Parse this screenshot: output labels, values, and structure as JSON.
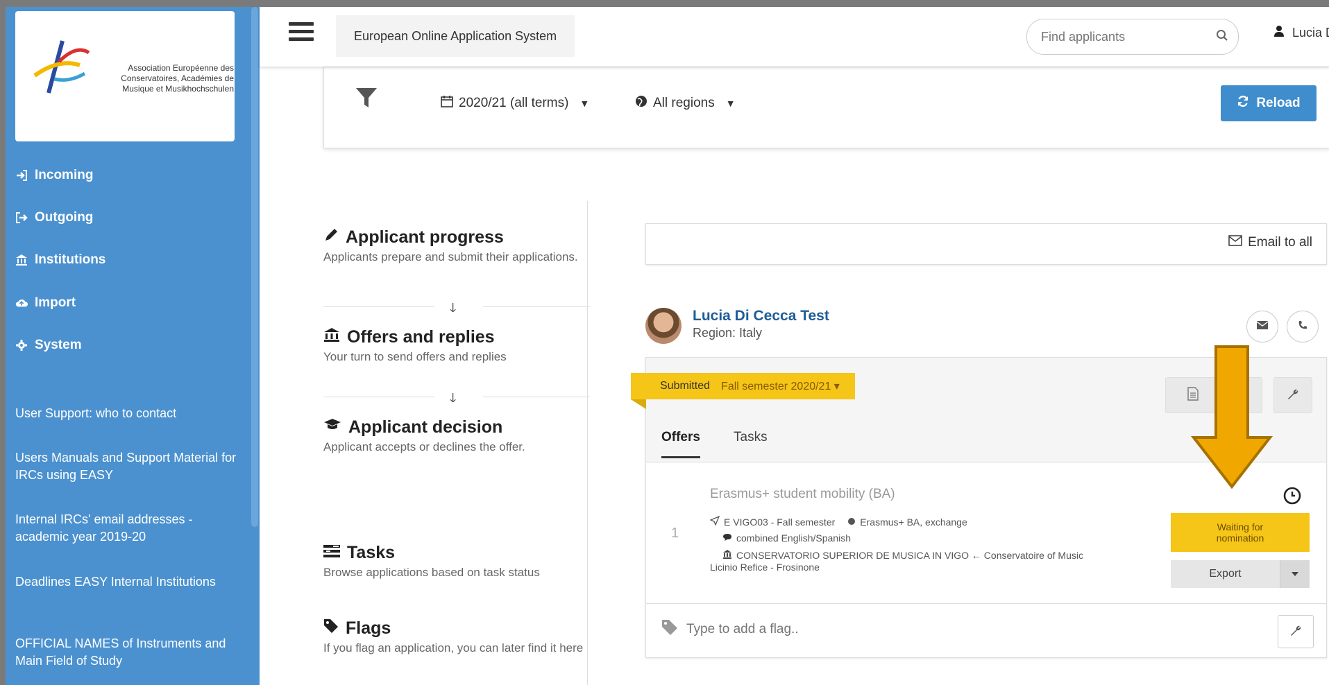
{
  "sidebar": {
    "logo_text": "Association Européenne des Conservatoires, Académies de Musique et Musikhochschulen",
    "nav": [
      {
        "label": "Incoming",
        "icon": "sign-in-icon"
      },
      {
        "label": "Outgoing",
        "icon": "sign-out-icon"
      },
      {
        "label": "Institutions",
        "icon": "bank-icon"
      },
      {
        "label": "Import",
        "icon": "cloud-upload-icon"
      },
      {
        "label": "System",
        "icon": "gear-icon"
      }
    ],
    "links": [
      "User Support: who to contact",
      "Users Manuals and Support Material for IRCs using EASY",
      "Internal IRCs' email addresses - academic year 2019-20",
      "Deadlines EASY Internal Institutions",
      "OFFICIAL NAMES of Instruments and Main Field of Study"
    ]
  },
  "header": {
    "title": "European Online Application System",
    "search_placeholder": "Find applicants",
    "user_name": "Lucia Di"
  },
  "filters": {
    "year": "2020/21 (all terms)",
    "region": "All regions",
    "reload_label": "Reload"
  },
  "steps": [
    {
      "title": "Applicant progress",
      "desc": "Applicants prepare and submit their applications.",
      "icon": "pencil-icon"
    },
    {
      "title": "Offers and replies",
      "desc": "Your turn to send offers and replies",
      "icon": "bank-icon"
    },
    {
      "title": "Applicant decision",
      "desc": "Applicant accepts or declines the offer.",
      "icon": "graduation-cap-icon"
    },
    {
      "title": "Tasks",
      "desc": "Browse applications based on task status",
      "icon": "tasks-icon"
    },
    {
      "title": "Flags",
      "desc": "If you flag an application, you can later find it here",
      "icon": "tag-icon"
    }
  ],
  "main": {
    "email_all_label": "Email to all",
    "applicant": {
      "name": "Lucia Di Cecca Test",
      "region": "Region: Italy"
    },
    "status": "Submitted",
    "semester": "Fall semester 2020/21",
    "tabs": [
      "Offers",
      "Tasks"
    ],
    "offer": {
      "number": "1",
      "title": "Erasmus+ student mobility (BA)",
      "code": "E VIGO03 - Fall semester",
      "program": "Erasmus+ BA, exchange",
      "language": "combined English/Spanish",
      "institutions_line1": "CONSERVATORIO SUPERIOR DE MUSICA IN VIGO ← Conservatoire of Music",
      "institutions_line2": "Licinio Refice - Frosinone",
      "badge_line1": "Waiting for",
      "badge_line2": "nomination",
      "export_label": "Export"
    },
    "flag_placeholder": "Type to add a flag.."
  },
  "colors": {
    "sidebar": "#4b91cf",
    "accent": "#3f8dcd",
    "status_yellow": "#f5c518",
    "annotation_arrow": "#f0a800"
  }
}
